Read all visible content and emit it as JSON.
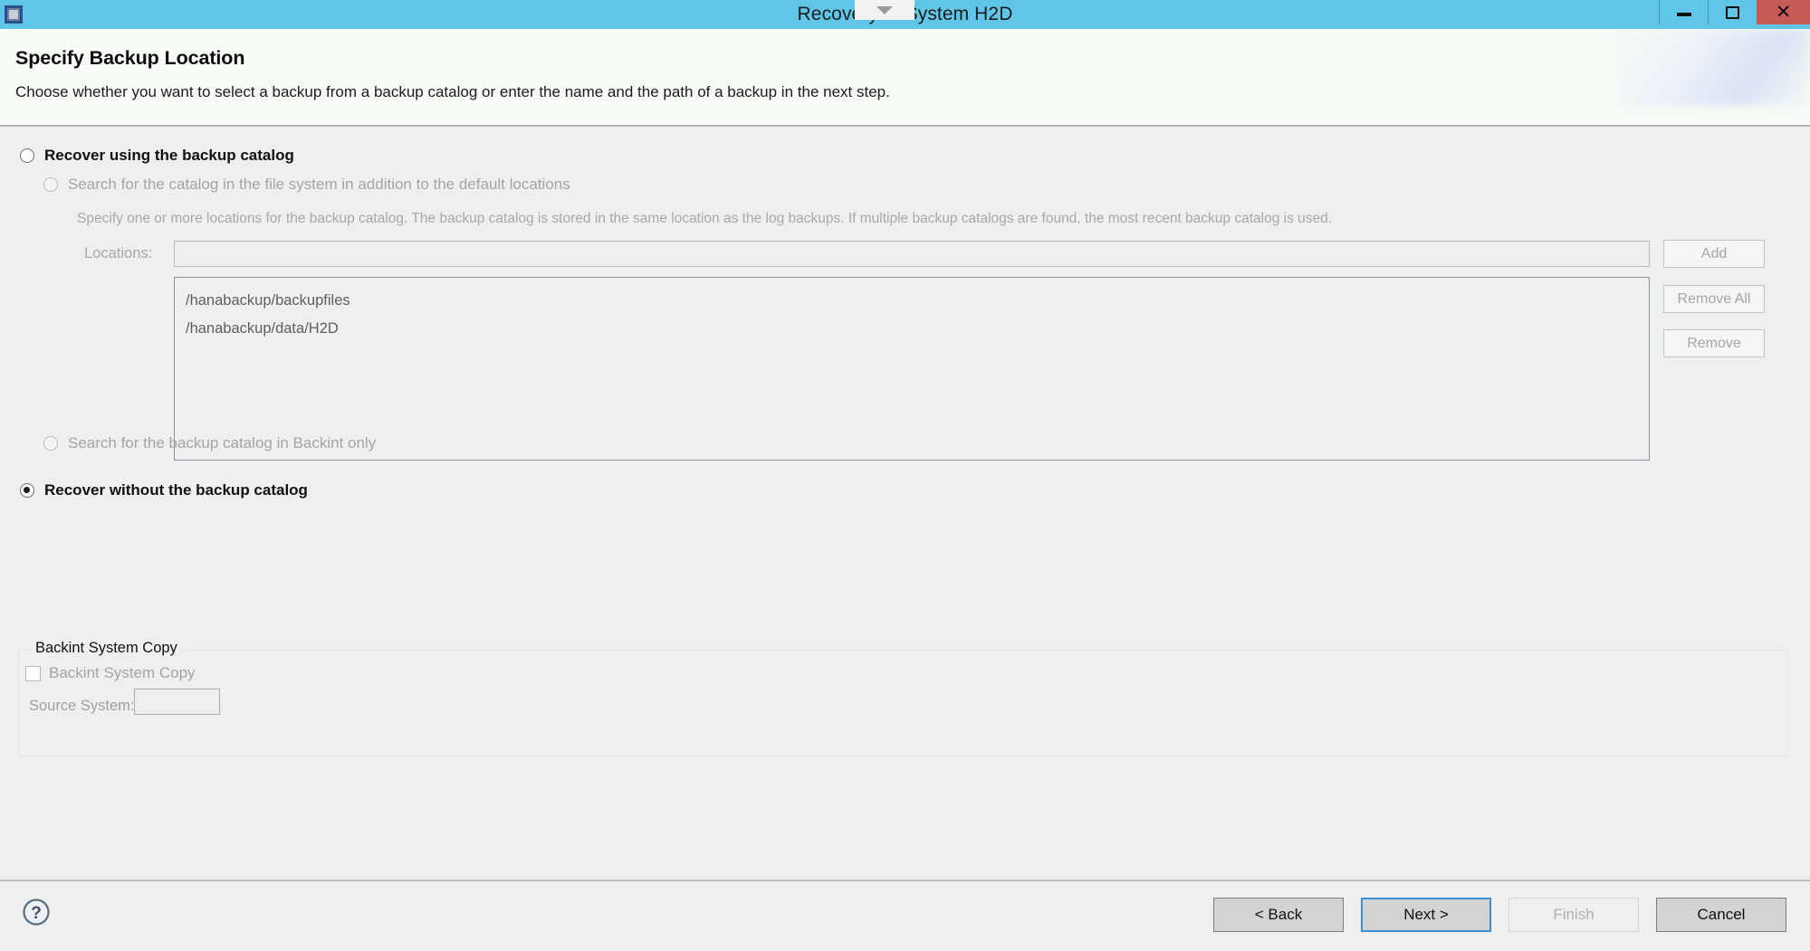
{
  "window": {
    "title": "Recovery of System H2D",
    "icon": "app-window-icon",
    "controls": {
      "minimize": "minimize-icon",
      "maximize": "maximize-icon",
      "close": "close-icon"
    },
    "accent_color": "#60c6e8",
    "close_color": "#c75b56"
  },
  "header": {
    "title": "Specify Backup Location",
    "description": "Choose whether you want to select a backup from a backup catalog or enter the name and the path of a backup in the next step."
  },
  "options": {
    "recover_using_catalog": {
      "label": "Recover using the backup catalog",
      "checked": false,
      "enabled": true
    },
    "search_file_system": {
      "label": "Search for the catalog in the file system in addition to the default locations",
      "checked": false,
      "enabled": false
    },
    "search_backint_only": {
      "label": "Search for the backup catalog in Backint only",
      "checked": false,
      "enabled": false
    },
    "recover_without_catalog": {
      "label": "Recover without the backup catalog",
      "checked": true,
      "enabled": true
    }
  },
  "catalog_section": {
    "hint": "Specify one or more locations for the backup catalog. The backup catalog is stored in the same location as the log backups. If multiple backup catalogs are found, the most recent backup catalog is used.",
    "locations_label": "Locations:",
    "locations_value": "",
    "locations_placeholder": "",
    "locations_list": [
      "/hanabackup/backupfiles",
      "/hanabackup/data/H2D"
    ],
    "buttons": {
      "add": "Add",
      "remove_all": "Remove All",
      "remove": "Remove"
    }
  },
  "backint_group": {
    "title": "Backint System Copy",
    "checkbox_label": "Backint System Copy",
    "checkbox_checked": false,
    "source_system_label": "Source System:",
    "source_system_value": ""
  },
  "footer": {
    "help_icon": "help-icon",
    "buttons": {
      "back": "< Back",
      "next": "Next >",
      "finish": "Finish",
      "cancel": "Cancel"
    },
    "focused_button": "next",
    "disabled_button": "finish"
  }
}
